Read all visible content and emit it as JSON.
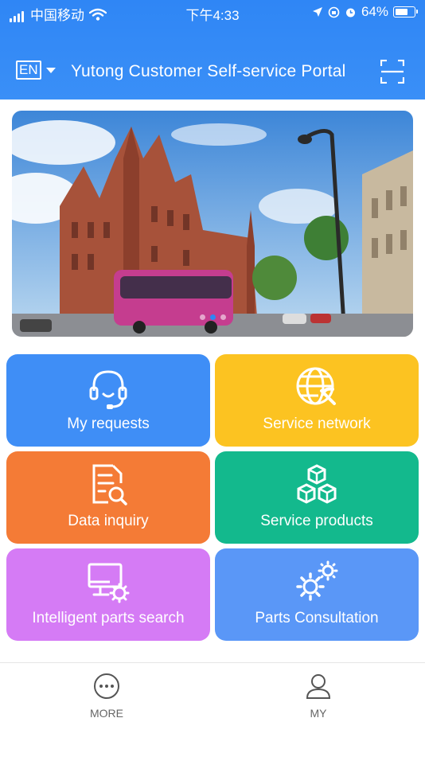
{
  "status_bar": {
    "carrier": "中国移动",
    "time": "下午4:33",
    "battery": "64%"
  },
  "header": {
    "language": "EN",
    "title": "Yutong Customer Self-service Portal"
  },
  "banner": {
    "slide_count": 3,
    "active_slide": 2
  },
  "tiles": [
    {
      "label": "My requests",
      "icon": "headset-icon",
      "color": "#3f8ef6"
    },
    {
      "label": "Service network",
      "icon": "globe-wrench-icon",
      "color": "#fcc321"
    },
    {
      "label": "Data inquiry",
      "icon": "document-search-icon",
      "color": "#f47b36"
    },
    {
      "label": "Service products",
      "icon": "cubes-icon",
      "color": "#13b98d"
    },
    {
      "label": "Intelligent parts search",
      "icon": "monitor-gear-icon",
      "color": "#d57bf5"
    },
    {
      "label": "Parts Consultation",
      "icon": "gears-icon",
      "color": "#5a97f7"
    }
  ],
  "bottom_nav": [
    {
      "label": "MORE",
      "icon": "more-icon"
    },
    {
      "label": "MY",
      "icon": "user-icon"
    }
  ]
}
